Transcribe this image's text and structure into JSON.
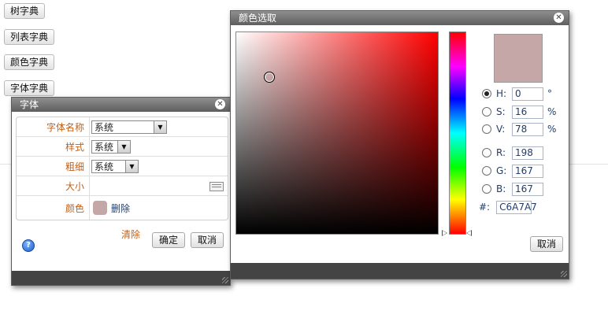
{
  "sidebar": {
    "buttons": [
      "树字典",
      "列表字典",
      "颜色字典",
      "字体字典"
    ]
  },
  "font_dialog": {
    "title": "字体",
    "rows": [
      {
        "label": "字体名称",
        "value": "系统"
      },
      {
        "label": "样式",
        "value": "系统"
      },
      {
        "label": "粗细",
        "value": "系统"
      },
      {
        "label": "大小",
        "value": ""
      },
      {
        "label": "颜色",
        "swatch_color": "#c6a7a7",
        "delete_label": "删除"
      }
    ],
    "clear_label": "清除",
    "ok_label": "确定",
    "cancel_label": "取消"
  },
  "color_dialog": {
    "title": "颜色选取",
    "current_color": "#c6a7a7",
    "fields": [
      {
        "label": "H:",
        "value": "0",
        "unit": "°",
        "selected": true
      },
      {
        "label": "S:",
        "value": "16",
        "unit": "%",
        "selected": false
      },
      {
        "label": "V:",
        "value": "78",
        "unit": "%",
        "selected": false
      },
      {
        "label": "R:",
        "value": "198",
        "unit": "",
        "selected": false
      },
      {
        "label": "G:",
        "value": "167",
        "unit": "",
        "selected": false
      },
      {
        "label": "B:",
        "value": "167",
        "unit": "",
        "selected": false
      }
    ],
    "hex_label": "#:",
    "hex_value": "C6A7A7",
    "cancel_label": "取消"
  },
  "colors": {
    "accent_label": "#c0611b",
    "title_bar": "#6b6b6b",
    "selected_color": "#c6a7a7"
  }
}
